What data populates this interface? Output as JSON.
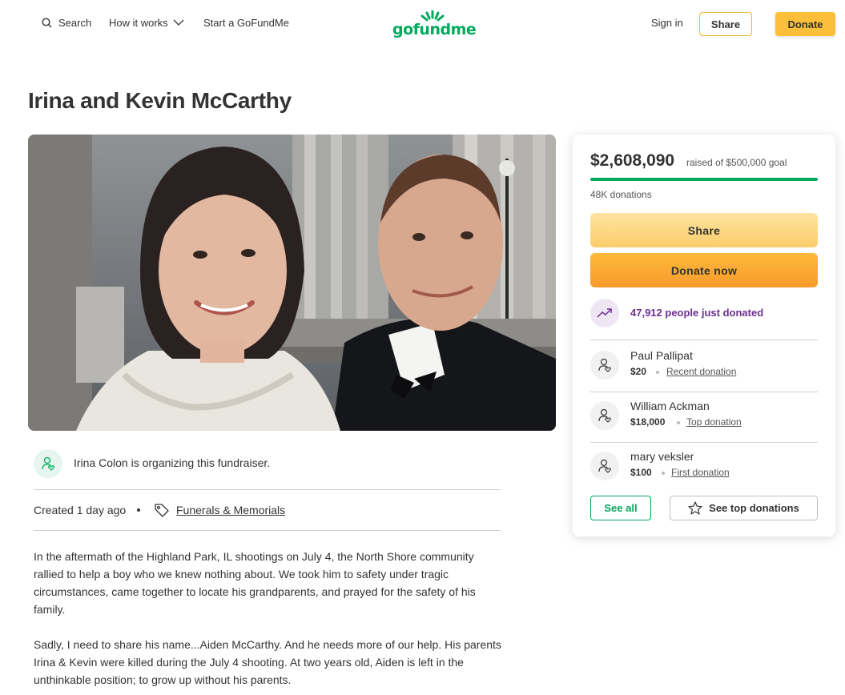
{
  "header": {
    "search_label": "Search",
    "how_label": "How it works",
    "start_label": "Start a GoFundMe",
    "logo_text": "gofundme",
    "signin_label": "Sign in",
    "share_label": "Share",
    "donate_label": "Donate"
  },
  "campaign": {
    "title": "Irina and Kevin McCarthy",
    "organizer_text": "Irina Colon is organizing this fundraiser.",
    "created_text": "Created 1 day ago",
    "category": "Funerals & Memorials",
    "story": [
      "In the aftermath of the Highland Park, IL shootings on July 4, the North Shore community rallied to help a boy who we knew nothing about. We took him to safety under tragic circumstances, came together to locate his grandparents, and prayed for the safety of his family.",
      "Sadly, I need to share his name...Aiden McCarthy. And he needs more of our help. His parents Irina & Kevin were killed during the July 4 shooting. At two years old, Aiden is left in the unthinkable position; to grow up without his parents."
    ]
  },
  "card": {
    "raised_amount": "$2,608,090",
    "raised_goal": "raised of $500,000 goal",
    "progress_fraction": 1.0,
    "donations_count": "48K donations",
    "share_label": "Share",
    "donate_now_label": "Donate now",
    "trend_text": "47,912 people just donated",
    "donors": [
      {
        "name": "Paul Pallipat",
        "amount": "$20",
        "tag": "Recent donation"
      },
      {
        "name": "William Ackman",
        "amount": "$18,000",
        "tag": "Top donation"
      },
      {
        "name": "mary veksler",
        "amount": "$100",
        "tag": "First donation"
      }
    ],
    "see_all_label": "See all",
    "see_top_label": "See top donations"
  },
  "colors": {
    "brand_green": "#02a95c",
    "donate_orange": "#fbbf3a",
    "trend_purple": "#6e2f8f"
  }
}
